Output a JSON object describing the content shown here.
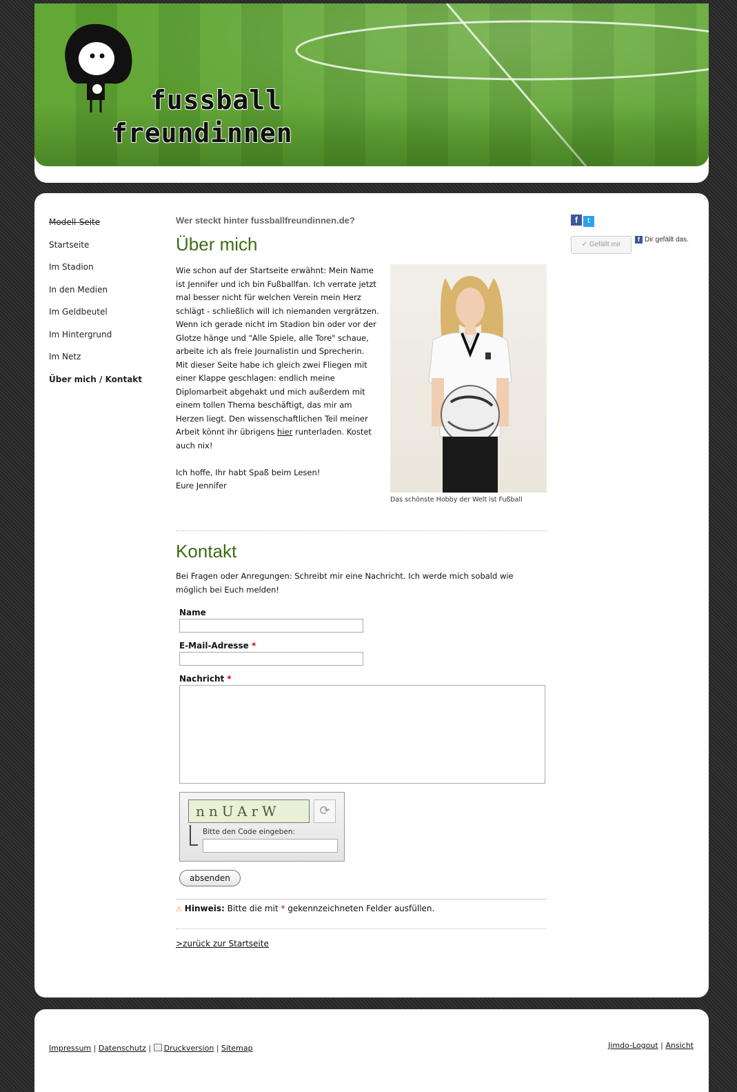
{
  "header": {
    "logo_line1": "fussball",
    "logo_line2": "freundinnen"
  },
  "nav": {
    "items": [
      {
        "label": "Modell-Seite"
      },
      {
        "label": "Startseite"
      },
      {
        "label": "Im Stadion"
      },
      {
        "label": "In den Medien"
      },
      {
        "label": "Im Geldbeutel"
      },
      {
        "label": "Im Hintergrund"
      },
      {
        "label": "Im Netz"
      },
      {
        "label": "Über mich / Kontakt"
      }
    ]
  },
  "content": {
    "subhead": "Wer steckt hinter fussballfreundinnen.de?",
    "about_title": "Über mich",
    "about_p1": "Wie schon auf der Startseite erwähnt: Mein Name ist Jennifer und ich bin Fußballfan. Ich verrate jetzt mal besser nicht für welchen Verein mein Herz schlägt - schließlich will ich niemanden vergrätzen. Wenn ich gerade nicht im Stadion bin oder vor der Glotze hänge und \"Alle Spiele, alle Tore\" schaue, arbeite ich als freie Journalistin und Sprecherin.",
    "about_p2_before": "Mit dieser Seite habe ich gleich zwei Fliegen mit einer Klappe geschlagen: endlich meine Diplomarbeit abgehakt und mich außerdem mit einem tollen Thema beschäftigt, das mir am Herzen liegt. Den wissenschaftlichen Teil meiner Arbeit könnt ihr übrigens ",
    "about_p2_link": "hier",
    "about_p2_after": " runterladen. Kostet auch nix!",
    "about_p3": "Ich hoffe, Ihr habt Spaß beim Lesen!",
    "about_p4": "Eure Jennifer",
    "photo_caption": "Das schönste Hobby der Welt ist Fußball",
    "kontakt_title": "Kontakt",
    "kontakt_intro": "Bei Fragen oder Anregungen: Schreibt mir eine Nachricht. Ich werde mich sobald wie möglich bei Euch melden!"
  },
  "form": {
    "name_label": "Name",
    "email_label": "E-Mail-Adresse",
    "message_label": "Nachricht",
    "required_mark": "*",
    "name_value": "",
    "email_value": "",
    "message_value": "",
    "captcha_text": "nnUArW",
    "captcha_label": "Bitte den Code eingeben:",
    "submit_label": "absenden",
    "hint_bold": "Hinweis:",
    "hint_before": " Bitte die mit ",
    "hint_after": " gekennzeichneten Felder ausfüllen.",
    "back_link": ">zurück zur Startseite"
  },
  "social": {
    "like_label": "✓ Gefällt mir",
    "like_note": "Dir gefällt das."
  },
  "footer": {
    "impressum": "Impressum",
    "datenschutz": "Datenschutz",
    "druckversion": "Druckversion",
    "sitemap": "Sitemap",
    "logout": "Jimdo-Logout",
    "ansicht": "Ansicht",
    "sep": " | "
  },
  "colors": {
    "heading_green": "#3d6b14",
    "required_red": "#c00",
    "facebook_blue": "#3b5998",
    "twitter_blue": "#2aa3ef"
  }
}
